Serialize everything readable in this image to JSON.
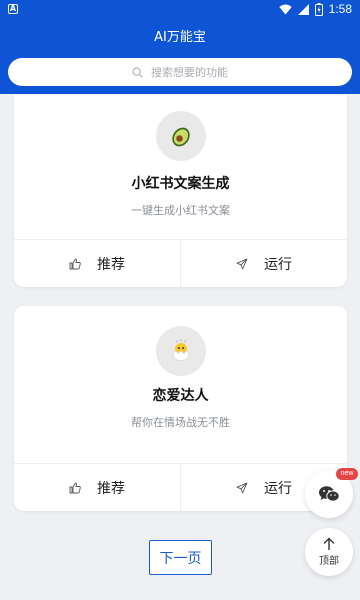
{
  "status_bar": {
    "time": "1:58"
  },
  "header": {
    "title": "AI万能宝"
  },
  "search": {
    "placeholder": "搜索想要的功能"
  },
  "cards": [
    {
      "title": "小红书文案生成",
      "subtitle": "一键生成小红书文案",
      "icon": "avocado-icon",
      "recommend_label": "推荐",
      "run_label": "运行"
    },
    {
      "title": "恋爱达人",
      "subtitle": "帮你在情场战无不胜",
      "icon": "hatching-chick-icon",
      "recommend_label": "推荐",
      "run_label": "运行"
    }
  ],
  "pagination": {
    "next_label": "下一页"
  },
  "floating": {
    "badge": "new",
    "top_label": "顶部"
  },
  "colors": {
    "primary": "#0d55d4",
    "background": "#eef0f4",
    "badge": "#e54545"
  }
}
